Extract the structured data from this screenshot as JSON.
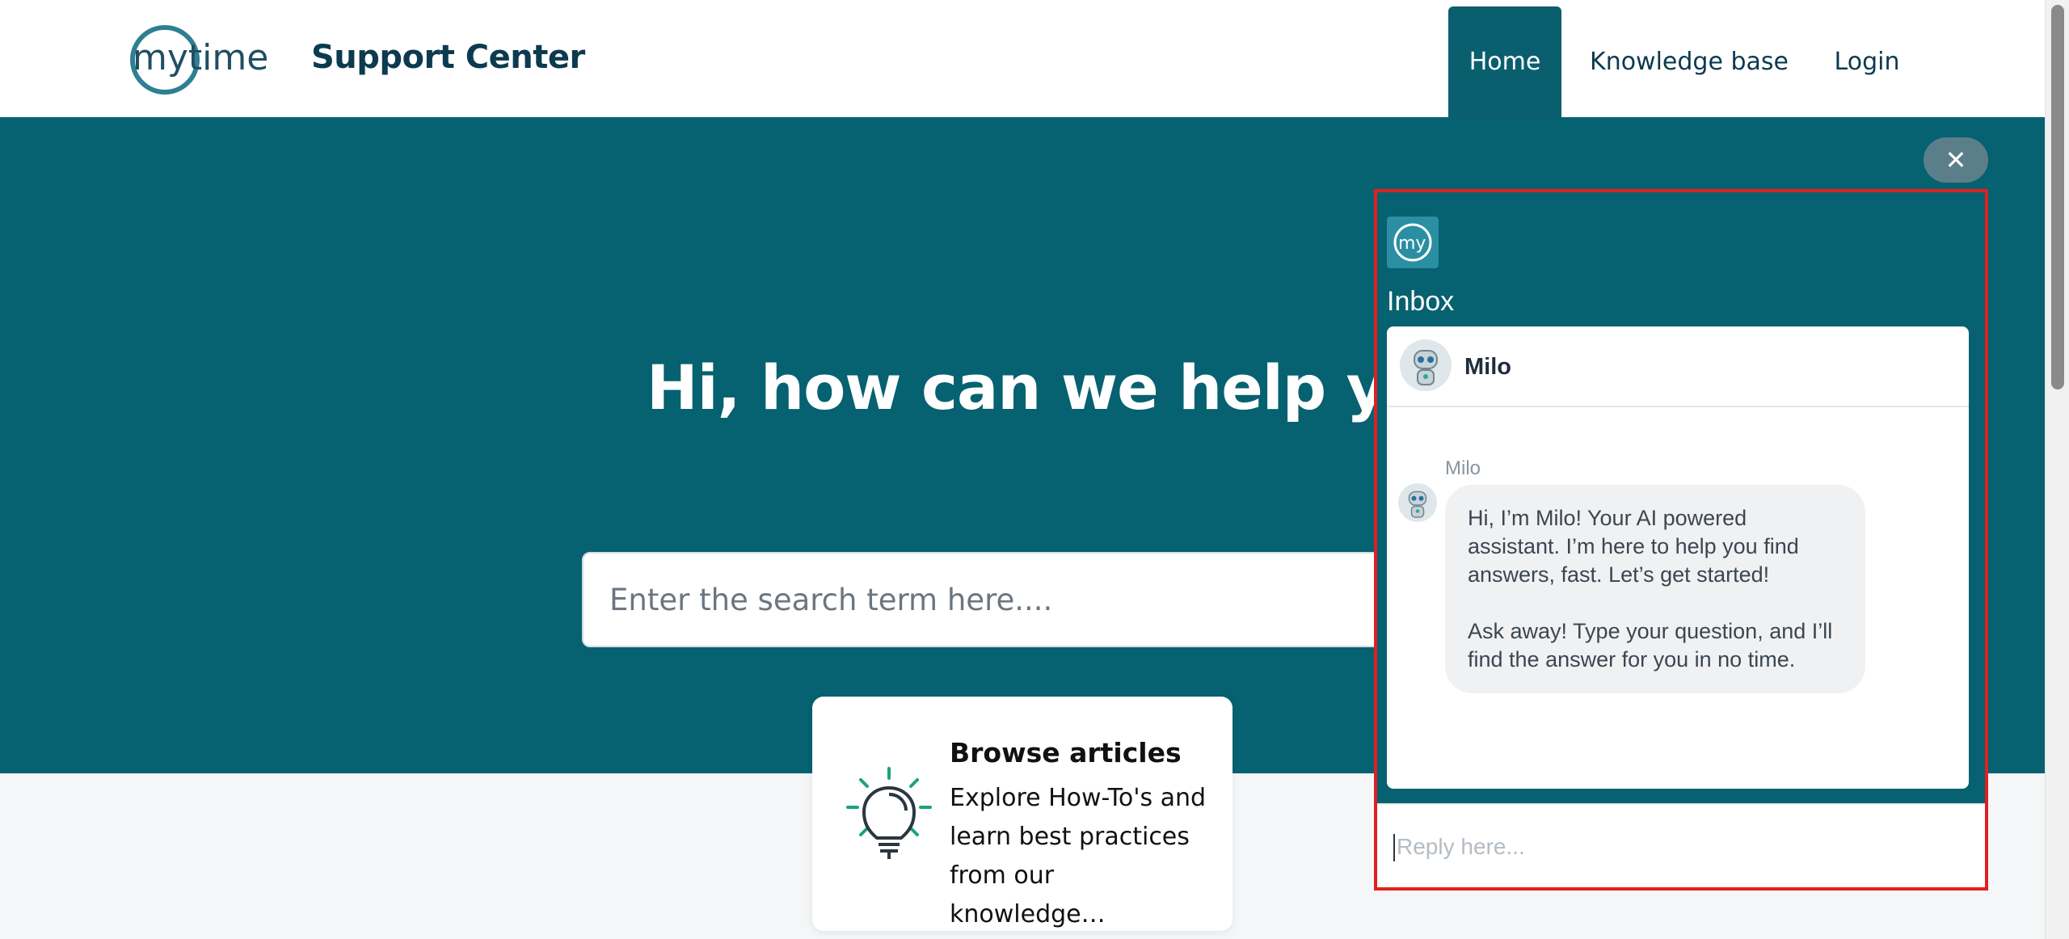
{
  "header": {
    "logo_text": "mytime",
    "site_title": "Support Center",
    "nav": {
      "home": "Home",
      "knowledge_base": "Knowledge base",
      "login": "Login"
    }
  },
  "hero": {
    "title": "Hi, how can we help you?",
    "search_placeholder": "Enter the search term here...."
  },
  "card": {
    "title": "Browse articles",
    "description": "Explore How-To's and learn best practices from our knowledge…"
  },
  "chat": {
    "close_label": "✕",
    "inbox_title": "Inbox",
    "agent_name": "Milo",
    "message_sender": "Milo",
    "message_paragraph_1": "Hi, I’m Milo! Your AI powered assistant. I’m here to help you find answers, fast. Let’s get started!",
    "message_paragraph_2": "Ask away! Type your question, and I’ll find the answer for you in no time.",
    "reply_placeholder": "Reply here..."
  },
  "colors": {
    "brand_teal": "#066170",
    "nav_active": "#0a5f6e",
    "highlight_border": "#e02020",
    "icon_green": "#1aa37f"
  }
}
